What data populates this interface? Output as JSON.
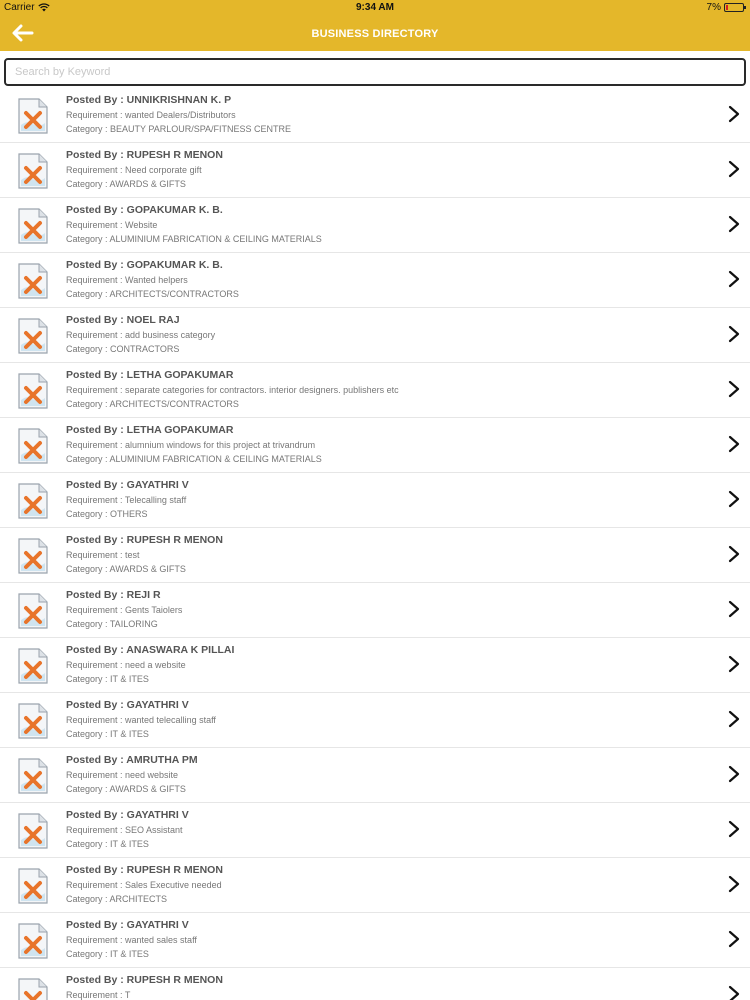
{
  "status_bar": {
    "carrier": "Carrier",
    "time": "9:34 AM",
    "battery": "7%",
    "wifi_icon": "wifi-icon",
    "battery_level": 0.07
  },
  "header": {
    "title": "BUSINESS DIRECTORY",
    "back_icon": "arrow-left-icon",
    "color": "#e4b72a"
  },
  "search": {
    "placeholder": "Search by Keyword",
    "value": ""
  },
  "listings": [
    {
      "posted_by": "Posted By : UNNIKRISHNAN K. P",
      "requirement": "Requirement : wanted Dealers/Distributors",
      "category": "Category : BEAUTY PARLOUR/SPA/FITNESS CENTRE"
    },
    {
      "posted_by": "Posted By : RUPESH R MENON",
      "requirement": "Requirement : Need corporate gift",
      "category": "Category : AWARDS & GIFTS"
    },
    {
      "posted_by": "Posted By : GOPAKUMAR K. B.",
      "requirement": "Requirement : Website",
      "category": "Category : ALUMINIUM FABRICATION & CEILING MATERIALS"
    },
    {
      "posted_by": "Posted By : GOPAKUMAR K. B.",
      "requirement": "Requirement : Wanted helpers",
      "category": "Category : ARCHITECTS/CONTRACTORS"
    },
    {
      "posted_by": "Posted By : NOEL RAJ",
      "requirement": "Requirement : add business category",
      "category": "Category : CONTRACTORS"
    },
    {
      "posted_by": "Posted By : LETHA GOPAKUMAR",
      "requirement": "Requirement : separate categories for contractors. interior designers. publishers etc",
      "category": "Category : ARCHITECTS/CONTRACTORS"
    },
    {
      "posted_by": "Posted By : LETHA GOPAKUMAR",
      "requirement": "Requirement : alumnium windows for this project at trivandrum",
      "category": "Category : ALUMINIUM FABRICATION & CEILING MATERIALS"
    },
    {
      "posted_by": "Posted By : GAYATHRI V",
      "requirement": "Requirement : Telecalling staff",
      "category": "Category : OTHERS"
    },
    {
      "posted_by": "Posted By : RUPESH R MENON",
      "requirement": "Requirement : test",
      "category": "Category : AWARDS & GIFTS"
    },
    {
      "posted_by": "Posted By : REJI R",
      "requirement": "Requirement : Gents Taiolers",
      "category": "Category : TAILORING"
    },
    {
      "posted_by": "Posted By : ANASWARA K PILLAI",
      "requirement": "Requirement : need a website",
      "category": "Category : IT & ITES"
    },
    {
      "posted_by": "Posted By : GAYATHRI V",
      "requirement": "Requirement : wanted telecalling staff",
      "category": "Category : IT & ITES"
    },
    {
      "posted_by": "Posted By : AMRUTHA PM",
      "requirement": "Requirement : need website",
      "category": "Category : AWARDS & GIFTS"
    },
    {
      "posted_by": "Posted By : GAYATHRI V",
      "requirement": "Requirement : SEO Assistant",
      "category": "Category : IT & ITES"
    },
    {
      "posted_by": "Posted By : RUPESH R MENON",
      "requirement": "Requirement : Sales Executive needed",
      "category": "Category : ARCHITECTS"
    },
    {
      "posted_by": "Posted By : GAYATHRI V",
      "requirement": "Requirement : wanted sales staff",
      "category": "Category : IT & ITES"
    },
    {
      "posted_by": "Posted By : RUPESH R MENON",
      "requirement": "Requirement : T",
      "category": ""
    }
  ],
  "row_icons": {
    "thumbnail": "broken-image-icon",
    "chevron": "chevron-right-icon"
  }
}
